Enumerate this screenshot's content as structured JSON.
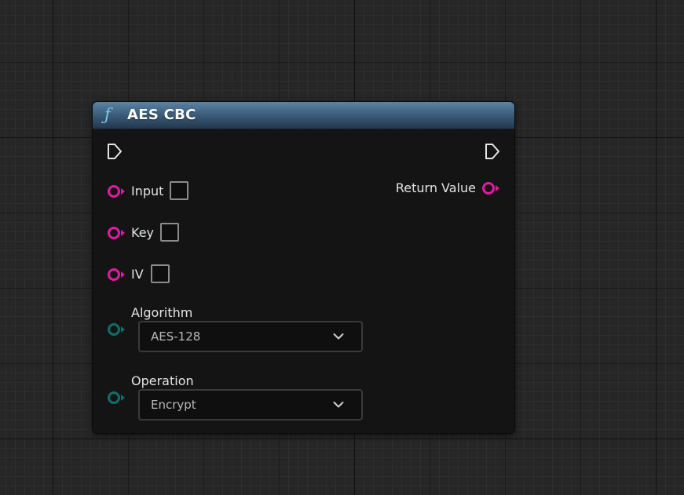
{
  "node": {
    "title": "AES CBC",
    "icon": "function-icon",
    "header_color": "#3d5f7d",
    "pin_colors": {
      "exec": "#e6e6e6",
      "bytes": "#e21aa3",
      "enum": "#0e6f6a"
    },
    "inputs": [
      {
        "label": "Input"
      },
      {
        "label": "Key"
      },
      {
        "label": "IV"
      }
    ],
    "output": {
      "label": "Return Value"
    },
    "algorithm": {
      "label": "Algorithm",
      "selected": "AES-128"
    },
    "operation": {
      "label": "Operation",
      "selected": "Encrypt"
    }
  }
}
